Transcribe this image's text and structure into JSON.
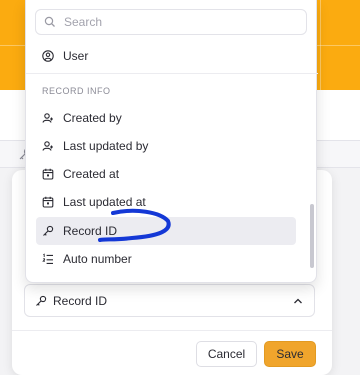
{
  "search": {
    "placeholder": "Search"
  },
  "menu": {
    "top_items": [
      {
        "label": "User",
        "icon": "user-circle-icon"
      }
    ],
    "section_title": "RECORD INFO",
    "record_items": [
      {
        "label": "Created by",
        "icon": "user-plus-icon"
      },
      {
        "label": "Last updated by",
        "icon": "user-plus-icon"
      },
      {
        "label": "Created at",
        "icon": "calendar-icon"
      },
      {
        "label": "Last updated at",
        "icon": "calendar-icon"
      },
      {
        "label": "Record ID",
        "icon": "key-icon",
        "active": true
      },
      {
        "label": "Auto number",
        "icon": "numbered-list-icon"
      }
    ]
  },
  "field": {
    "selected": "Record ID",
    "icon": "key-icon"
  },
  "actions": {
    "cancel": "Cancel",
    "save": "Save"
  },
  "colors": {
    "brand": "#fbab10",
    "save": "#f0a52c",
    "annotation": "#1438d6"
  }
}
